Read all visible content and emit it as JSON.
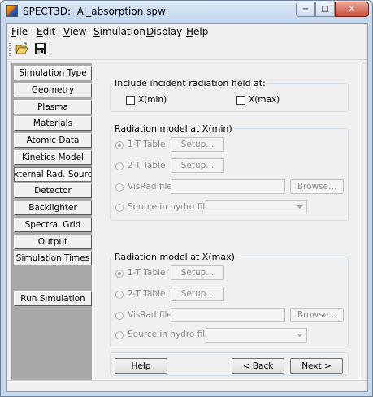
{
  "window": {
    "title": "SPECT3D:  Al_absorption.spw",
    "minimize_glyph": "−",
    "maximize_glyph": "□",
    "close_glyph": "✕"
  },
  "menu": [
    {
      "label": "File",
      "key": "F",
      "rest": "ile"
    },
    {
      "label": "Edit",
      "key": "E",
      "rest": "dit"
    },
    {
      "label": "View",
      "key": "V",
      "rest": "iew"
    },
    {
      "label": "Simulation",
      "key": "S",
      "rest": "imulation"
    },
    {
      "label": "Display",
      "key": "D",
      "rest": "isplay"
    },
    {
      "label": "Help",
      "key": "H",
      "rest": "elp"
    }
  ],
  "toolbar": {
    "icons": [
      "open-folder-icon",
      "save-disk-icon"
    ]
  },
  "nav": {
    "items": [
      {
        "label": "Simulation Type"
      },
      {
        "label": "Geometry"
      },
      {
        "label": "Plasma"
      },
      {
        "label": "Materials"
      },
      {
        "label": "Atomic Data"
      },
      {
        "label": "Kinetics Model"
      },
      {
        "label": "External Rad. Source",
        "active": true
      },
      {
        "label": "Detector"
      },
      {
        "label": "Backlighter"
      },
      {
        "label": "Spectral Grid"
      },
      {
        "label": "Output"
      },
      {
        "label": "Simulation Times"
      }
    ],
    "run_label": "Run Simulation"
  },
  "incident": {
    "title": "Include incident radiation field at:",
    "xmin_label": "X(min)",
    "xmin_checked": false,
    "xmax_label": "X(max)",
    "xmax_checked": false
  },
  "model_xmin": {
    "title": "Radiation model at X(min)",
    "opt1": "1-T Table",
    "opt2": "2-T Table",
    "opt3": "VisRad file",
    "opt4": "Source in hydro file:",
    "setup": "Setup...",
    "browse": "Browse...",
    "selected": "1-T Table",
    "file_value": "",
    "hydro_value": ""
  },
  "model_xmax": {
    "title": "Radiation model at X(max)",
    "opt1": "1-T Table",
    "opt2": "2-T Table",
    "opt3": "VisRad file",
    "opt4": "Source in hydro file:",
    "setup": "Setup...",
    "browse": "Browse...",
    "selected": "1-T Table",
    "file_value": "",
    "hydro_value": ""
  },
  "footer": {
    "help": "Help",
    "back": "< Back",
    "next": "Next >"
  }
}
